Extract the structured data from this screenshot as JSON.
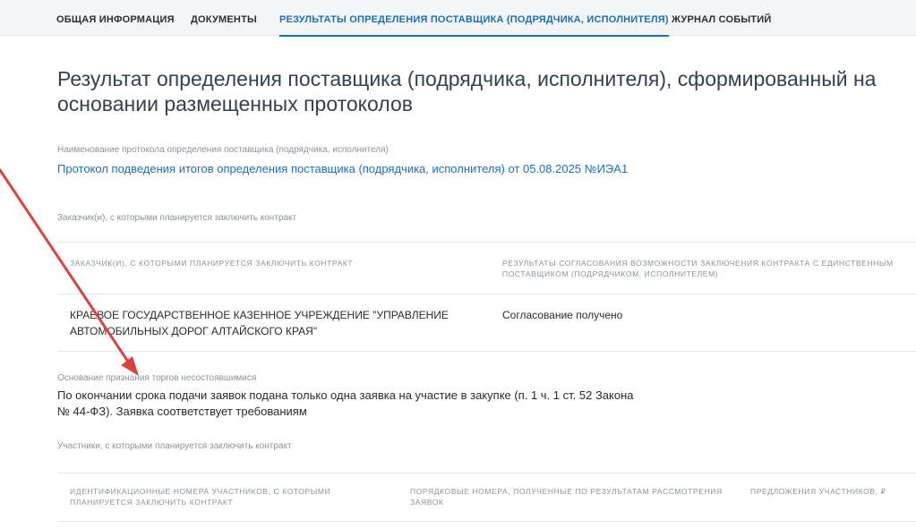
{
  "tabs": [
    {
      "label": "ОБЩАЯ ИНФОРМАЦИЯ",
      "active": false
    },
    {
      "label": "ДОКУМЕНТЫ",
      "active": false
    },
    {
      "label": "РЕЗУЛЬТАТЫ ОПРЕДЕЛЕНИЯ ПОСТАВЩИКА (ПОДРЯДЧИКА, ИСПОЛНИТЕЛЯ)",
      "active": true
    },
    {
      "label": "ЖУРНАЛ СОБЫТИЙ",
      "active": false
    }
  ],
  "main": {
    "title": "Результат определения поставщика (подрядчика, исполнителя), сформированный на основании размещенных протоколов",
    "protocol_label": "Наименование протокола определения поставщика (подрядчика, исполнителя)",
    "protocol_link": "Протокол подведения итогов определения поставщика (подрядчика, исполнителя) от 05.08.2025 №ИЭА1",
    "customers_label": "Заказчик(и), с которыми планируется заключить контракт",
    "customers_table": {
      "headers": [
        "ЗАКАЗЧИК(И), С КОТОРЫМИ ПЛАНИРУЕТСЯ ЗАКЛЮЧИТЬ КОНТРАКТ",
        "РЕЗУЛЬТАТЫ СОГЛАСОВАНИЯ ВОЗМОЖНОСТИ ЗАКЛЮЧЕНИЯ КОНТРАКТА С ЕДИНСТВЕННЫМ ПОСТАВЩИКОМ (ПОДРЯДЧИКОМ, ИСПОЛНИТЕЛЕМ)"
      ],
      "rows": [
        [
          "КРАЕВОЕ ГОСУДАРСТВЕННОЕ КАЗЕННОЕ УЧРЕЖДЕНИЕ \"УПРАВЛЕНИЕ АВТОМОБИЛЬНЫХ ДОРОГ АЛТАЙСКОГО КРАЯ\"",
          "Согласование получено"
        ]
      ]
    },
    "basis_label": "Основание признания торгов несостоявшимися",
    "basis_text": "По окончании срока подачи заявок подана только одна заявка на участие в закупке (п. 1 ч. 1 ст. 52 Закона № 44-ФЗ). Заявка соответствует требованиям",
    "participants_label": "Участники, с которыми планируется заключить контракт",
    "participants_table": {
      "headers": [
        "ИДЕНТИФИКАЦИОННЫЕ НОМЕРА УЧАСТНИКОВ, С КОТОРЫМИ ПЛАНИРУЕТСЯ ЗАКЛЮЧИТЬ КОНТРАКТ",
        "ПОРЯДКОВЫЕ НОМЕРА, ПОЛУЧЕННЫЕ ПО РЕЗУЛЬТАТАМ РАССМОТРЕНИЯ ЗАЯВОК",
        "ПРЕДЛОЖЕНИЯ УЧАСТНИКОВ, ₽"
      ]
    }
  },
  "colors": {
    "accent": "#1d6fb8",
    "annotation_arrow": "#d9453a",
    "tab_bar_bg": "#f3f5f7"
  }
}
